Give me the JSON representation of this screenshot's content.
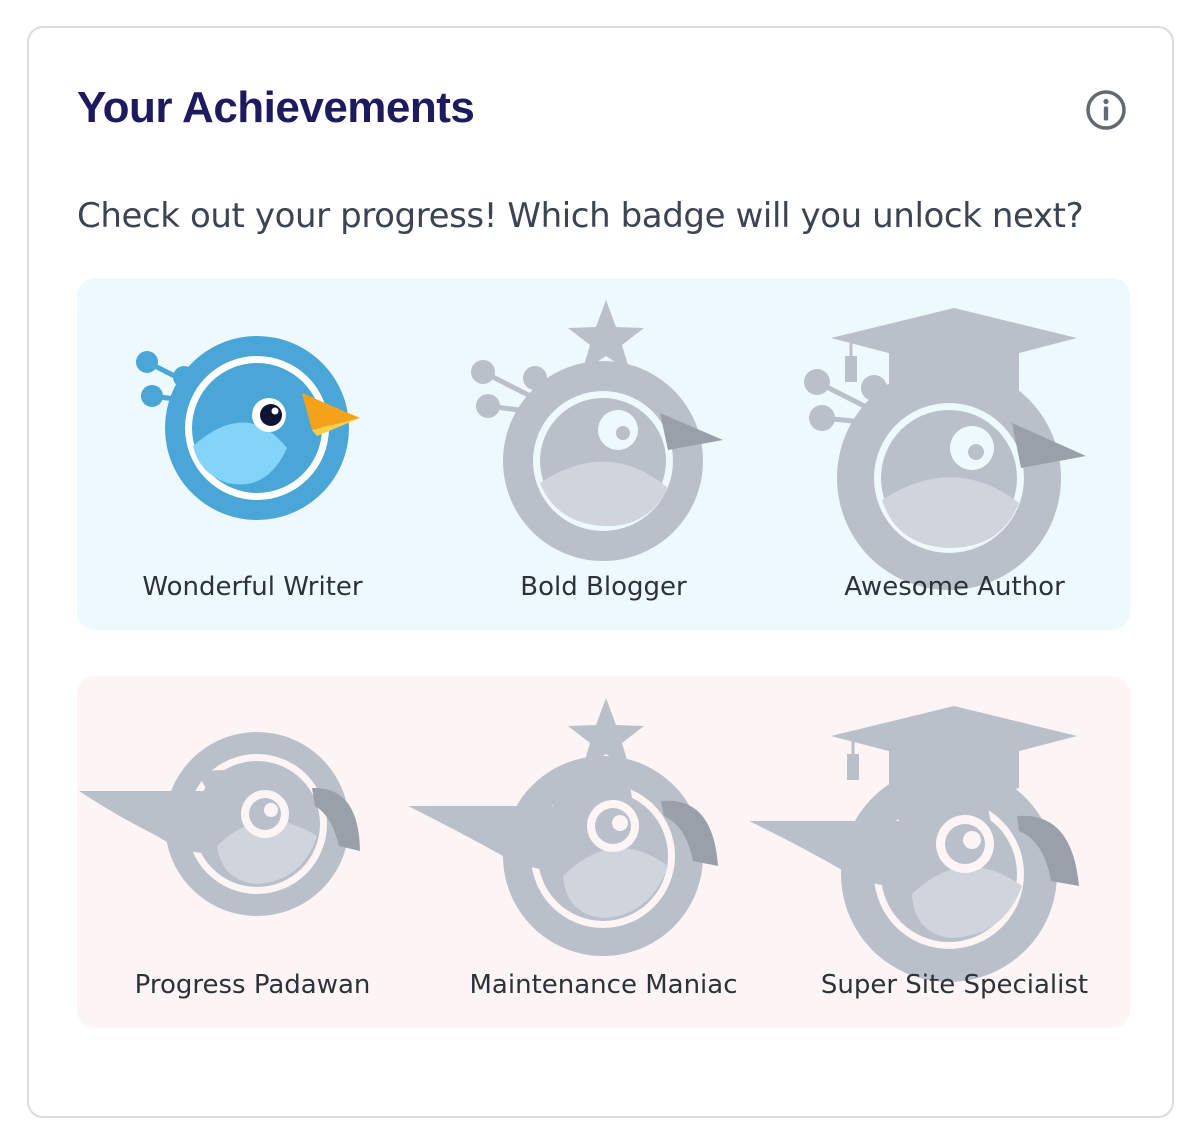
{
  "achievements": {
    "title": "Your Achievements",
    "subtitle": "Check out your progress! Which badge will you unlock next?",
    "info_icon": "info-circle-icon",
    "colors": {
      "title": "#1e1a5e",
      "blogging_bg": "#eef9fe",
      "maintenance_bg": "#fdf4f5",
      "earned_blue": "#4ba6d8",
      "locked_gray": "#bac0ca"
    },
    "blogging_badges": [
      {
        "label": "Wonderful Writer",
        "earned": true
      },
      {
        "label": "Bold Blogger",
        "earned": false
      },
      {
        "label": "Awesome Author",
        "earned": false
      }
    ],
    "maintenance_badges": [
      {
        "label": "Progress Padawan",
        "earned": false
      },
      {
        "label": "Maintenance Maniac",
        "earned": false
      },
      {
        "label": "Super Site Specialist",
        "earned": false
      }
    ]
  }
}
